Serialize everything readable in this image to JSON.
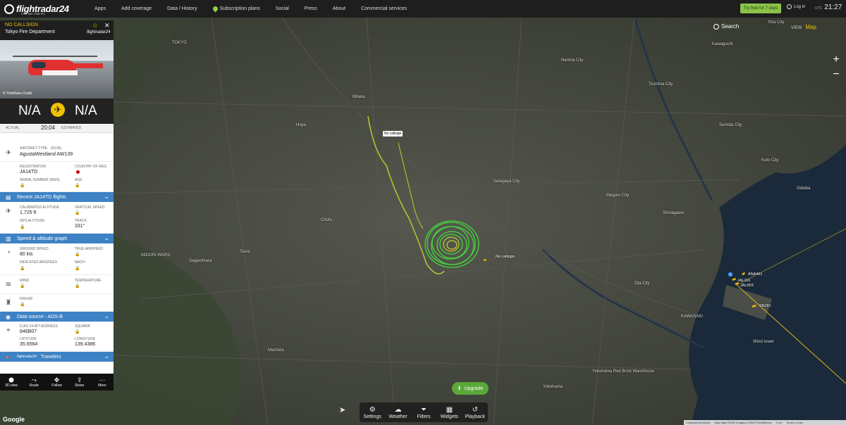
{
  "topnav": {
    "logo_text": "flightradar24",
    "logo_sub": "LIVE AIR TRAFFIC",
    "items": [
      "Apps",
      "Add coverage",
      "Data / History",
      "Subscription plans",
      "Social",
      "Press",
      "About",
      "Commercial services"
    ],
    "try_label": "Try free for 7 days",
    "login_label": "Log in",
    "clock_zone": "UTC",
    "clock_time": "21:27"
  },
  "map": {
    "search_label": "Search",
    "view_label": "VIEW",
    "view_value": "Map",
    "zoom_in": "+",
    "zoom_out": "−",
    "callsign_tag_1": "No callsign",
    "callsign_tag_2": "No callsign",
    "planes": [
      "ANA461",
      "JAL116",
      "JAL003",
      "SNJ91"
    ],
    "place_labels": [
      "TOKYO",
      "Kita City",
      "Nerima City",
      "Toshima City",
      "Sumida City",
      "Setagaya City",
      "Shinagawa",
      "Meguro City",
      "MIDORI-WARD",
      "KAWASAKI",
      "Yokohama",
      "Chofu",
      "Machida",
      "Sagamihara",
      "Hoya",
      "Tama",
      "Mitaka",
      "Kawaguchi",
      "Koto City",
      "Odaiba",
      "Ota City",
      "Wind tower",
      "Yokohama Red Brick Warehouse"
    ]
  },
  "panel": {
    "callsign": "NO CALLSIGN",
    "operator": "Tokyo Fire Department",
    "photo_credit": "© Yoshiharu Ozaki",
    "brand": "flightradar24",
    "origin": "N/A",
    "destination": "N/A",
    "actual_label": "ACTUAL",
    "actual_time": "20:04",
    "estimated_label": "ESTIMATED",
    "aircraft_type_label": "AIRCRAFT TYPE",
    "aircraft_type_code": "(A139)",
    "aircraft_type_value": "AgustaWestland AW139",
    "registration_label": "REGISTRATION",
    "registration_value": "JA14TD",
    "country_label": "COUNTRY OF REG.",
    "serial_label": "SERIAL NUMBER (MSN)",
    "age_label": "AGE",
    "recent_flights_band": "Recent JA14TD flights",
    "cal_alt_label": "CALIBRATED ALTITUDE",
    "cal_alt_value": "1,725 ft",
    "vert_speed_label": "VERTICAL SPEED",
    "gps_alt_label": "GPS ALTITUDE",
    "track_label": "TRACK",
    "track_value": "331°",
    "speed_band": "Speed & altitude graph",
    "ground_speed_label": "GROUND SPEED",
    "ground_speed_value": "80 kts",
    "true_airspeed_label": "TRUE AIRSPEED",
    "indicated_label": "INDICATED AIRSPEED",
    "mach_label": "MACH",
    "wind_label": "WIND",
    "temperature_label": "TEMPERATURE",
    "fir_label": "FIR/UIR",
    "data_source_band": "Data source - ADS-B",
    "icao_label": "ICAO 24-BIT ADDRESS",
    "icao_value": "846B07",
    "squawk_label": "SQUAWK",
    "latitude_label": "LATITUDE",
    "latitude_value": "35.6564",
    "longitude_label": "LONGITUDE",
    "longitude_value": "139.4386",
    "travelers_brand": "flightradar24",
    "travelers_band": "Travelers"
  },
  "panel_toolbar": [
    "3D view",
    "Route",
    "Follow",
    "Share",
    "More"
  ],
  "dock": [
    "Settings",
    "Weather",
    "Filters",
    "Widgets",
    "Playback"
  ],
  "upgrade_label": "Upgrade",
  "google_label": "Google",
  "attribution": [
    "Keyboard shortcuts",
    "Map data ©2022 Imagery ©2022 TerraMetrics",
    "2 km",
    "Terms of Use"
  ],
  "colors": {
    "accent_yellow": "#f2c200",
    "band_blue": "#3d82c4",
    "track_green": "#33cc33",
    "upgrade_green": "#5aa83a"
  }
}
